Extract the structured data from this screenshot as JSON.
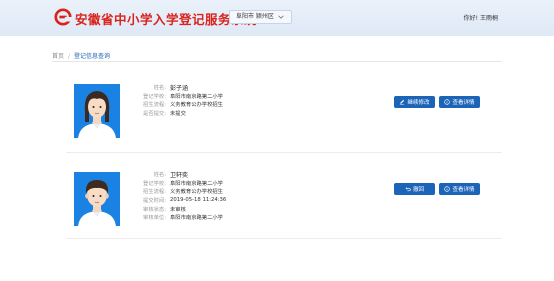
{
  "header": {
    "title": "安徽省中小学入学登记服务系统",
    "region": "阜阳市 颍州区",
    "greeting": "你好! 王雨桐"
  },
  "breadcrumb": {
    "home": "首页",
    "separator": "/",
    "current": "登记信息查询"
  },
  "records": [
    {
      "fields": [
        {
          "label": "姓名:",
          "value": "彭子涵"
        },
        {
          "label": "登记学校:",
          "value": "阜阳市南京路第二小学"
        },
        {
          "label": "招生流程:",
          "value": "义务教育公办学校招生"
        },
        {
          "label": "是否提交:",
          "value": "未提交"
        }
      ],
      "buttons": [
        {
          "label": "继续修改",
          "icon": "edit-icon"
        },
        {
          "label": "查看详情",
          "icon": "info-icon"
        }
      ]
    },
    {
      "fields": [
        {
          "label": "姓名:",
          "value": "卫轩奕"
        },
        {
          "label": "登记学校:",
          "value": "阜阳市南京路第二小学"
        },
        {
          "label": "招生流程:",
          "value": "义务教育公办学校招生"
        },
        {
          "label": "提交时间:",
          "value": "2019-05-18 11:24:36"
        },
        {
          "label": "审核状态:",
          "value": "未审核"
        },
        {
          "label": "审核单位:",
          "value": "阜阳市南京路第二小学"
        }
      ],
      "buttons": [
        {
          "label": "撤回",
          "icon": "undo-icon"
        },
        {
          "label": "查看详情",
          "icon": "info-icon"
        }
      ]
    }
  ],
  "colors": {
    "brand_red": "#d9231c",
    "primary_blue": "#1b64b8",
    "photo_bg": "#1a82e2"
  }
}
